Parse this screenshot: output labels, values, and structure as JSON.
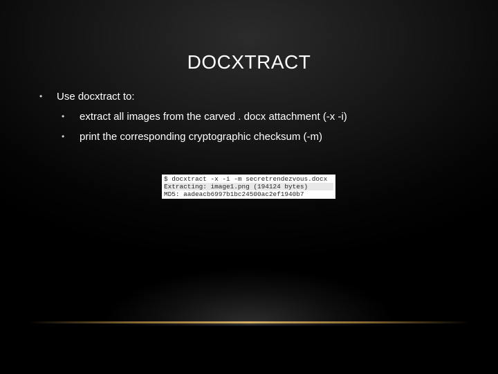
{
  "slide": {
    "title": "DOCXTRACT",
    "bullets": {
      "main": "Use docxtract to:",
      "sub": [
        "extract all images from the carved . docx attachment (-x -i)",
        "print the corresponding cryptographic checksum (-m)"
      ],
      "marker": "•"
    },
    "terminal": {
      "lines": [
        "$ docxtract -x -i -m secretrendezvous.docx",
        "Extracting: image1.png (194124 bytes)",
        "MD5: aadeacb6997b1bc24500ac2ef1940b7"
      ]
    }
  }
}
